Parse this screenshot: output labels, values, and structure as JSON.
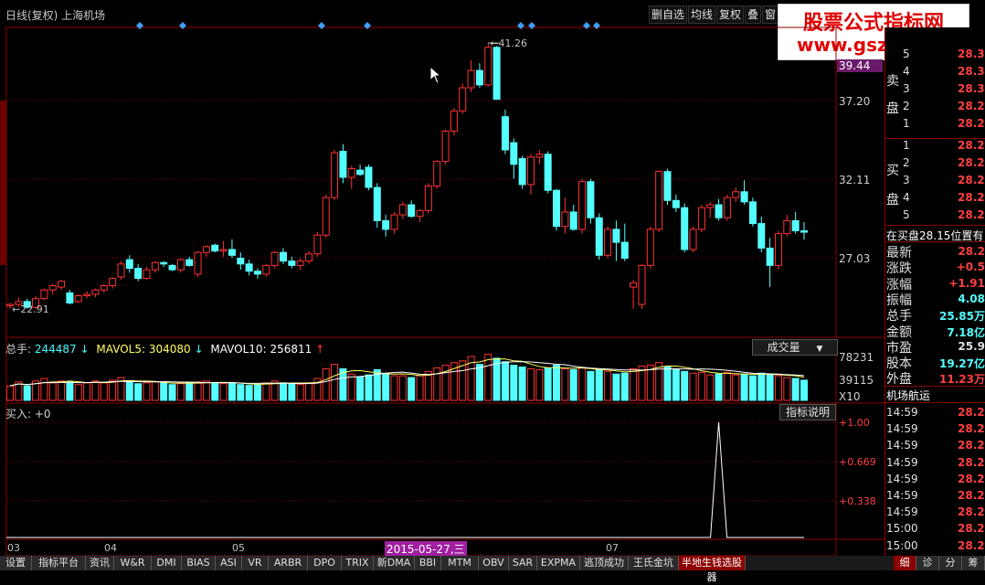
{
  "header": {
    "title": "日线(复权)  上海机场",
    "buttons": [
      "删自选",
      "均线",
      "复权",
      "叠",
      "窗"
    ]
  },
  "watermark": {
    "line1": "股票公式指标网",
    "line2": "www.gszb.com"
  },
  "price_axis": [
    "39.44",
    "37.20",
    "32.11",
    "27.03"
  ],
  "annotations": {
    "high": "41.26",
    "low": "22.91"
  },
  "volume": {
    "label_total": "总手:",
    "total": "244487",
    "label_ma5": "MAVOL5:",
    "ma5": "304080",
    "label_ma10": "MAVOL10:",
    "ma10": "256811",
    "selector": "成交量",
    "axis": [
      "78231",
      "39115",
      "X10"
    ]
  },
  "indicator": {
    "label": "买入: +0",
    "help_button": "指标说明",
    "axis": [
      "+1.00",
      "+0.669",
      "+0.338"
    ]
  },
  "x_axis": [
    "03",
    "04",
    "05",
    "07"
  ],
  "x_highlight": "2015-05-27,三",
  "right_panel": {
    "sell_label": [
      "卖",
      "盘"
    ],
    "sell_rows": [
      {
        "n": "5",
        "p": "28.3"
      },
      {
        "n": "4",
        "p": "28.3"
      },
      {
        "n": "3",
        "p": "28.3"
      },
      {
        "n": "2",
        "p": "28.2"
      },
      {
        "n": "1",
        "p": "28.2"
      }
    ],
    "buy_label": [
      "买",
      "盘"
    ],
    "buy_rows": [
      {
        "n": "1",
        "p": "28.2"
      },
      {
        "n": "2",
        "p": "28.2"
      },
      {
        "n": "3",
        "p": "28.2"
      },
      {
        "n": "4",
        "p": "28.2"
      },
      {
        "n": "5",
        "p": "28.2"
      }
    ],
    "note": "在买盘28.15位置有",
    "stats": [
      {
        "k": "最新",
        "v": "28.2"
      },
      {
        "k": "涨跌",
        "v": "+0.5"
      },
      {
        "k": "涨幅",
        "v": "+1.91"
      },
      {
        "k": "振幅",
        "v": "4.08"
      },
      {
        "k": "总手",
        "v": "25.85万"
      },
      {
        "k": "金额",
        "v": "7.18亿"
      },
      {
        "k": "市盈",
        "v": "25.9"
      },
      {
        "k": "股本",
        "v": "19.27亿"
      },
      {
        "k": "外盘",
        "v": "11.23万"
      }
    ],
    "name": "机场航运",
    "ticks": [
      {
        "t": "14:59",
        "p": "28.2"
      },
      {
        "t": "14:59",
        "p": "28.2"
      },
      {
        "t": "14:59",
        "p": "28.2"
      },
      {
        "t": "14:59",
        "p": "28.2"
      },
      {
        "t": "14:59",
        "p": "28.2"
      },
      {
        "t": "14:59",
        "p": "28.2"
      },
      {
        "t": "14:59",
        "p": "28.2"
      },
      {
        "t": "15:00",
        "p": "28.2"
      },
      {
        "t": "15:00",
        "p": "28.2"
      }
    ]
  },
  "tabs": [
    "设置",
    "指标平台",
    "资讯",
    "W&R",
    "DMI",
    "BIAS",
    "ASI",
    "VR",
    "ARBR",
    "DPO",
    "TRIX",
    "新DMA",
    "BBI",
    "MTM",
    "OBV",
    "SAR",
    "EXPMA",
    "逃顶成功",
    "王氏金坑",
    "半地生钱选股器"
  ],
  "active_tab": "半地生钱选股器",
  "right_tabs": [
    "细",
    "诊",
    "分",
    "筹"
  ],
  "chart_data": {
    "type": "candlestick",
    "description_units": "price (CNY)",
    "price_range": [
      22.0,
      42.0
    ],
    "candles": [
      [
        23.1,
        23.3,
        22.9,
        23.2
      ],
      [
        23.2,
        23.7,
        23.0,
        23.4
      ],
      [
        23.4,
        23.6,
        22.9,
        23.0
      ],
      [
        23.0,
        23.8,
        22.9,
        23.6
      ],
      [
        23.6,
        24.3,
        23.5,
        24.2
      ],
      [
        24.2,
        24.6,
        23.9,
        24.5
      ],
      [
        24.4,
        24.9,
        24.2,
        24.8
      ],
      [
        24.0,
        24.2,
        23.2,
        23.3
      ],
      [
        23.4,
        23.9,
        23.3,
        23.8
      ],
      [
        23.8,
        24.1,
        23.6,
        23.9
      ],
      [
        23.9,
        24.3,
        23.7,
        24.2
      ],
      [
        24.2,
        24.6,
        24.0,
        24.5
      ],
      [
        24.5,
        25.1,
        24.3,
        25.0
      ],
      [
        25.1,
        26.2,
        24.9,
        26.0
      ],
      [
        26.3,
        26.6,
        25.4,
        25.7
      ],
      [
        25.7,
        26.0,
        24.8,
        25.0
      ],
      [
        25.0,
        25.8,
        24.9,
        25.6
      ],
      [
        25.6,
        26.2,
        25.4,
        26.1
      ],
      [
        26.1,
        26.2,
        25.8,
        26.0
      ],
      [
        25.9,
        26.0,
        25.5,
        25.6
      ],
      [
        25.6,
        26.4,
        25.4,
        26.3
      ],
      [
        26.3,
        26.5,
        25.8,
        25.9
      ],
      [
        25.3,
        26.9,
        25.1,
        26.8
      ],
      [
        26.8,
        27.3,
        26.5,
        27.2
      ],
      [
        27.3,
        27.4,
        26.8,
        26.9
      ],
      [
        26.9,
        27.6,
        26.5,
        27.0
      ],
      [
        27.0,
        27.7,
        26.4,
        26.6
      ],
      [
        26.4,
        26.8,
        25.6,
        26.0
      ],
      [
        26.0,
        26.3,
        25.2,
        25.5
      ],
      [
        25.5,
        25.7,
        25.0,
        25.3
      ],
      [
        25.3,
        26.0,
        25.1,
        25.9
      ],
      [
        25.9,
        26.9,
        25.7,
        26.8
      ],
      [
        26.8,
        27.1,
        26.0,
        26.2
      ],
      [
        26.2,
        26.5,
        25.7,
        25.9
      ],
      [
        25.9,
        26.4,
        25.6,
        26.2
      ],
      [
        26.2,
        26.9,
        26.0,
        26.7
      ],
      [
        26.7,
        28.2,
        26.5,
        28.0
      ],
      [
        28.0,
        30.8,
        27.8,
        30.6
      ],
      [
        30.6,
        33.9,
        30.4,
        33.7
      ],
      [
        33.8,
        34.3,
        31.6,
        32.0
      ],
      [
        32.0,
        32.8,
        31.2,
        32.6
      ],
      [
        32.5,
        32.9,
        32.1,
        32.2
      ],
      [
        32.7,
        32.9,
        31.1,
        31.3
      ],
      [
        31.3,
        31.6,
        28.5,
        29.0
      ],
      [
        29.0,
        29.4,
        27.9,
        28.4
      ],
      [
        28.4,
        29.6,
        28.1,
        29.4
      ],
      [
        29.4,
        30.3,
        29.1,
        30.1
      ],
      [
        30.1,
        30.4,
        29.2,
        29.3
      ],
      [
        29.3,
        29.8,
        28.9,
        29.7
      ],
      [
        29.7,
        31.6,
        29.5,
        31.4
      ],
      [
        31.4,
        33.2,
        31.2,
        33.1
      ],
      [
        33.1,
        35.3,
        32.9,
        35.2
      ],
      [
        35.2,
        36.8,
        34.9,
        36.6
      ],
      [
        36.6,
        38.5,
        36.4,
        38.2
      ],
      [
        38.2,
        40.1,
        37.9,
        39.4
      ],
      [
        39.4,
        39.9,
        38.2,
        38.4
      ],
      [
        38.4,
        41.3,
        38.3,
        41.0
      ],
      [
        41.0,
        41.1,
        38.8,
        37.4
      ],
      [
        36.2,
        36.7,
        33.6,
        33.9
      ],
      [
        34.4,
        34.7,
        31.9,
        32.9
      ],
      [
        33.3,
        33.5,
        31.2,
        31.5
      ],
      [
        31.5,
        33.6,
        30.8,
        33.4
      ],
      [
        33.4,
        33.9,
        32.9,
        33.6
      ],
      [
        33.6,
        33.8,
        30.9,
        31.1
      ],
      [
        31.1,
        31.2,
        28.3,
        28.6
      ],
      [
        28.6,
        30.6,
        28.1,
        29.6
      ],
      [
        29.6,
        30.1,
        28.3,
        28.4
      ],
      [
        28.4,
        31.9,
        28.1,
        31.7
      ],
      [
        31.7,
        31.9,
        28.8,
        29.2
      ],
      [
        29.2,
        29.5,
        26.3,
        26.6
      ],
      [
        26.6,
        28.6,
        26.4,
        28.4
      ],
      [
        28.4,
        29.0,
        26.2,
        27.5
      ],
      [
        27.5,
        28.8,
        26.2,
        26.4
      ],
      [
        24.4,
        24.9,
        22.9,
        24.7
      ],
      [
        23.2,
        26.0,
        22.9,
        25.9
      ],
      [
        25.9,
        28.6,
        25.7,
        28.4
      ],
      [
        28.4,
        32.5,
        28.2,
        32.4
      ],
      [
        32.4,
        32.6,
        30.1,
        30.4
      ],
      [
        30.4,
        30.8,
        29.6,
        29.9
      ],
      [
        29.9,
        30.2,
        26.8,
        27.0
      ],
      [
        27.0,
        28.6,
        26.8,
        28.4
      ],
      [
        28.4,
        30.1,
        28.2,
        29.9
      ],
      [
        29.9,
        30.3,
        29.2,
        30.1
      ],
      [
        30.1,
        30.5,
        29.0,
        29.2
      ],
      [
        29.2,
        30.8,
        29.0,
        30.6
      ],
      [
        30.6,
        31.3,
        30.3,
        31.0
      ],
      [
        31.0,
        31.8,
        30.1,
        30.3
      ],
      [
        30.3,
        30.6,
        28.6,
        28.8
      ],
      [
        28.8,
        29.3,
        26.8,
        27.1
      ],
      [
        27.1,
        27.8,
        24.4,
        25.9
      ],
      [
        25.9,
        28.3,
        25.6,
        28.1
      ],
      [
        28.1,
        29.4,
        27.9,
        29.0
      ],
      [
        29.0,
        29.6,
        28.1,
        28.3
      ],
      [
        28.3,
        28.9,
        27.7,
        28.2
      ]
    ],
    "volume_ratios": [
      0.33,
      0.42,
      0.33,
      0.44,
      0.5,
      0.4,
      0.44,
      0.42,
      0.36,
      0.4,
      0.44,
      0.4,
      0.46,
      0.52,
      0.44,
      0.38,
      0.4,
      0.42,
      0.4,
      0.36,
      0.38,
      0.4,
      0.42,
      0.44,
      0.4,
      0.38,
      0.4,
      0.36,
      0.34,
      0.36,
      0.4,
      0.44,
      0.4,
      0.38,
      0.36,
      0.4,
      0.5,
      0.72,
      0.82,
      0.72,
      0.6,
      0.54,
      0.58,
      0.7,
      0.62,
      0.56,
      0.56,
      0.52,
      0.56,
      0.66,
      0.74,
      0.8,
      0.86,
      0.9,
      1.0,
      0.82,
      1.05,
      0.96,
      0.88,
      0.8,
      0.76,
      0.72,
      0.7,
      0.74,
      0.8,
      0.72,
      0.7,
      0.74,
      0.66,
      0.7,
      0.66,
      0.6,
      0.62,
      0.72,
      0.78,
      0.8,
      0.86,
      0.76,
      0.7,
      0.66,
      0.62,
      0.64,
      0.58,
      0.6,
      0.64,
      0.58,
      0.6,
      0.56,
      0.62,
      0.6,
      0.56,
      0.52,
      0.5,
      0.46
    ],
    "indicator_signal_index": 83,
    "signal_markers": [
      3,
      20,
      40,
      48,
      82,
      85,
      99,
      102
    ]
  }
}
